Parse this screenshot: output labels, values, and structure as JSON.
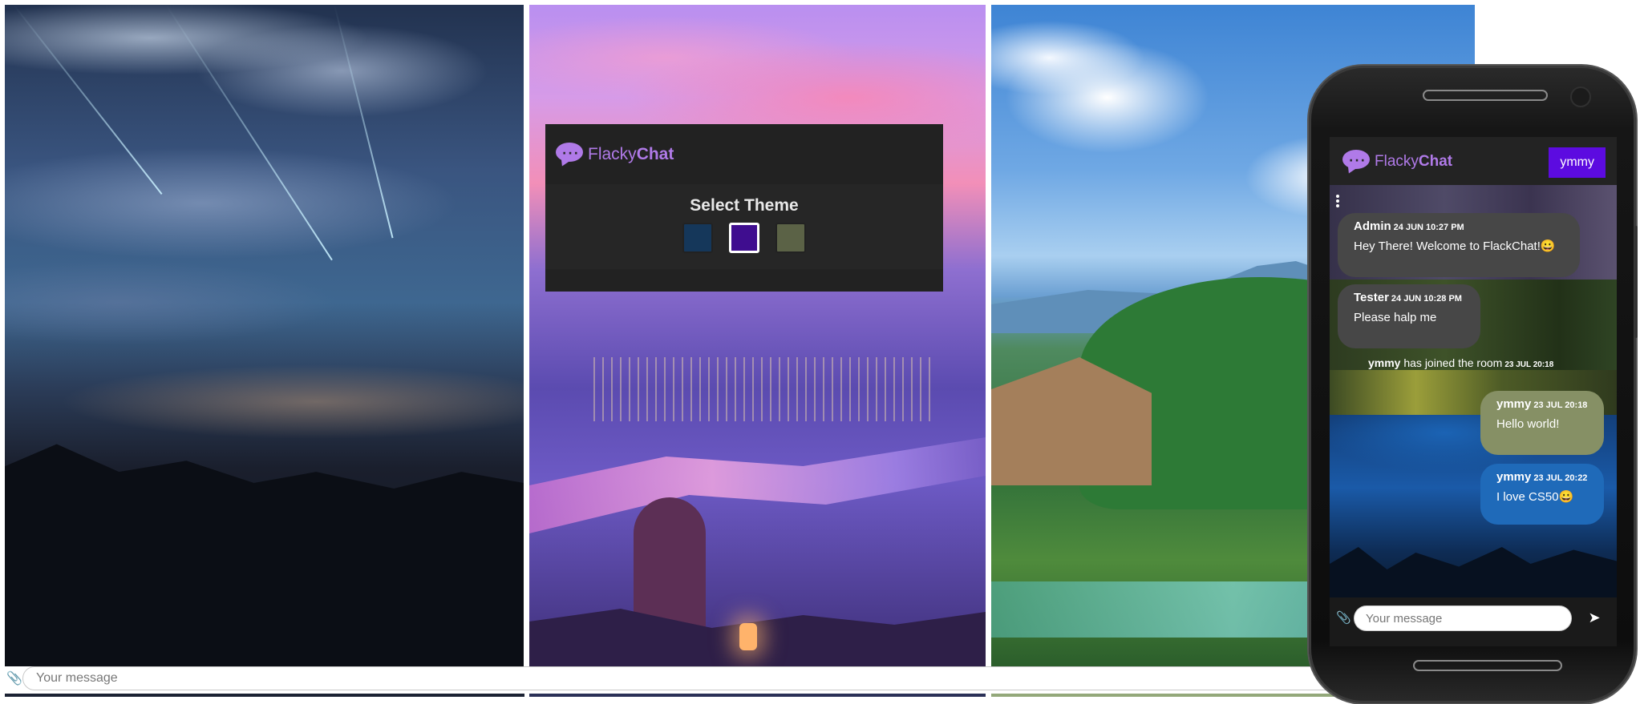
{
  "brand": {
    "first": "Flacky",
    "second": "Chat",
    "color": "#b07ae8"
  },
  "theme_dialog": {
    "title": "Select Theme",
    "swatches": [
      {
        "name": "blue-theme",
        "color": "#15375a",
        "selected": false
      },
      {
        "name": "purple-theme",
        "color": "#3f0d8f",
        "selected": true
      },
      {
        "name": "green-theme",
        "color": "#5b6246",
        "selected": false
      }
    ]
  },
  "left_composer": {
    "placeholder": "Your message",
    "attach_icon": "paperclip-icon"
  },
  "phone": {
    "user_button": "ymmy",
    "user_button_color": "#5c0be0",
    "messages": [
      {
        "author": "Admin",
        "time": "24 JUN 10:27 PM",
        "text": "Hey There! Welcome to FlackChat!😀"
      },
      {
        "author": "Tester",
        "time": "24 JUN 10:28 PM",
        "text": "Please halp me"
      },
      {
        "author": "ymmy",
        "time": "23 JUL 20:18",
        "text": "Hello world!"
      },
      {
        "author": "ymmy",
        "time": "23 JUL 20:22",
        "text": "I love CS50😀"
      }
    ],
    "system_message": {
      "user": "ymmy",
      "text": "has joined the room",
      "time": "23 JUL 20:18"
    },
    "composer": {
      "placeholder": "Your message",
      "attach_icon": "paperclip-icon",
      "send_icon": "send-icon"
    }
  }
}
